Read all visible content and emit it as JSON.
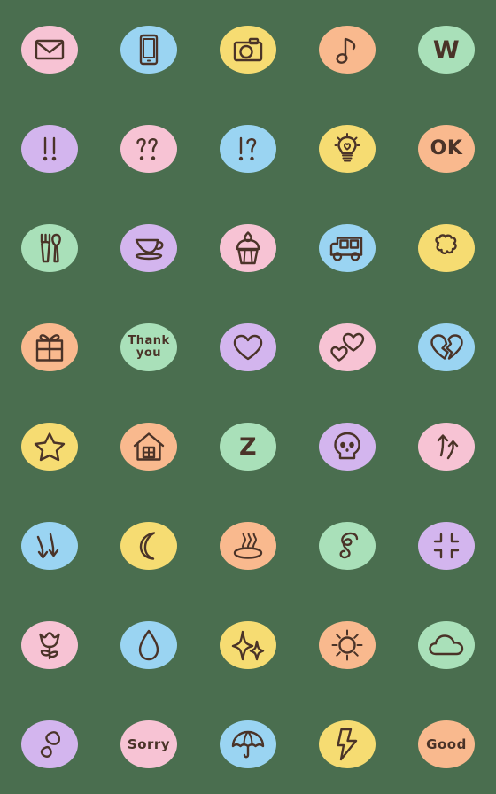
{
  "sheet": {
    "title": "Emoji Sticker Sheet",
    "background_color": "#4a6e4f",
    "ink_color": "#4a3328",
    "columns": 5,
    "rows": 8,
    "palette": {
      "pink": "#f7c3d4",
      "blue": "#9ad4f2",
      "yellow": "#f6dc72",
      "orange": "#f9b98e",
      "green": "#a9e0b9",
      "purple": "#d3b5ee",
      "pink_light": "#f9c9dc"
    }
  },
  "stickers": [
    {
      "row": 1,
      "col": 1,
      "name": "envelope-icon",
      "label": "envelope",
      "color": "#f7c3d4",
      "kind": "icon",
      "text": ""
    },
    {
      "row": 1,
      "col": 2,
      "name": "mobile-phone-icon",
      "label": "mobile phone",
      "color": "#9ad4f2",
      "kind": "icon",
      "text": ""
    },
    {
      "row": 1,
      "col": 3,
      "name": "camera-icon",
      "label": "camera",
      "color": "#f6dc72",
      "kind": "icon",
      "text": ""
    },
    {
      "row": 1,
      "col": 4,
      "name": "music-note-icon",
      "label": "music note",
      "color": "#f9b98e",
      "kind": "icon",
      "text": ""
    },
    {
      "row": 1,
      "col": 5,
      "name": "letter-w-icon",
      "label": "letter W",
      "color": "#a9e0b9",
      "kind": "text",
      "text": "W"
    },
    {
      "row": 2,
      "col": 1,
      "name": "double-exclamation-icon",
      "label": "double exclamation",
      "color": "#d3b5ee",
      "kind": "icon",
      "text": "!!"
    },
    {
      "row": 2,
      "col": 2,
      "name": "double-question-icon",
      "label": "double question",
      "color": "#f7c3d4",
      "kind": "icon",
      "text": "??"
    },
    {
      "row": 2,
      "col": 3,
      "name": "exclamation-question-icon",
      "label": "exclamation question",
      "color": "#9ad4f2",
      "kind": "icon",
      "text": "!?"
    },
    {
      "row": 2,
      "col": 4,
      "name": "lightbulb-icon",
      "label": "light bulb",
      "color": "#f6dc72",
      "kind": "icon",
      "text": ""
    },
    {
      "row": 2,
      "col": 5,
      "name": "ok-text-icon",
      "label": "OK",
      "color": "#f9b98e",
      "kind": "text",
      "text": "OK"
    },
    {
      "row": 3,
      "col": 1,
      "name": "fork-and-spoon-icon",
      "label": "fork and spoon",
      "color": "#a9e0b9",
      "kind": "icon",
      "text": ""
    },
    {
      "row": 3,
      "col": 2,
      "name": "teacup-icon",
      "label": "teacup",
      "color": "#d3b5ee",
      "kind": "icon",
      "text": ""
    },
    {
      "row": 3,
      "col": 3,
      "name": "cupcake-icon",
      "label": "cupcake",
      "color": "#f7c3d4",
      "kind": "icon",
      "text": ""
    },
    {
      "row": 3,
      "col": 4,
      "name": "bus-icon",
      "label": "bus",
      "color": "#9ad4f2",
      "kind": "icon",
      "text": ""
    },
    {
      "row": 3,
      "col": 5,
      "name": "popcorn-icon",
      "label": "popcorn",
      "color": "#f6dc72",
      "kind": "icon",
      "text": ""
    },
    {
      "row": 4,
      "col": 1,
      "name": "gift-icon",
      "label": "gift box",
      "color": "#f9b98e",
      "kind": "icon",
      "text": ""
    },
    {
      "row": 4,
      "col": 2,
      "name": "thank-you-text-icon",
      "label": "Thank you",
      "color": "#a9e0b9",
      "kind": "text2",
      "text": "Thank",
      "text2": "you"
    },
    {
      "row": 4,
      "col": 3,
      "name": "heart-icon",
      "label": "heart",
      "color": "#d3b5ee",
      "kind": "icon",
      "text": ""
    },
    {
      "row": 4,
      "col": 4,
      "name": "two-hearts-icon",
      "label": "two hearts",
      "color": "#f7c3d4",
      "kind": "icon",
      "text": ""
    },
    {
      "row": 4,
      "col": 5,
      "name": "broken-heart-icon",
      "label": "broken heart",
      "color": "#9ad4f2",
      "kind": "icon",
      "text": ""
    },
    {
      "row": 5,
      "col": 1,
      "name": "star-icon",
      "label": "star",
      "color": "#f6dc72",
      "kind": "icon",
      "text": ""
    },
    {
      "row": 5,
      "col": 2,
      "name": "house-icon",
      "label": "house",
      "color": "#f9b98e",
      "kind": "icon",
      "text": ""
    },
    {
      "row": 5,
      "col": 3,
      "name": "sleep-z-icon",
      "label": "sleeping Z",
      "color": "#a9e0b9",
      "kind": "text",
      "text": "Z"
    },
    {
      "row": 5,
      "col": 4,
      "name": "skull-icon",
      "label": "skull",
      "color": "#d3b5ee",
      "kind": "icon",
      "text": ""
    },
    {
      "row": 5,
      "col": 5,
      "name": "up-arrows-icon",
      "label": "up arrows",
      "color": "#f7c3d4",
      "kind": "icon",
      "text": ""
    },
    {
      "row": 6,
      "col": 1,
      "name": "down-arrows-icon",
      "label": "down arrows",
      "color": "#9ad4f2",
      "kind": "icon",
      "text": ""
    },
    {
      "row": 6,
      "col": 2,
      "name": "crescent-moon-icon",
      "label": "crescent moon",
      "color": "#f6dc72",
      "kind": "icon",
      "text": ""
    },
    {
      "row": 6,
      "col": 3,
      "name": "hot-spring-icon",
      "label": "hot spring",
      "color": "#f9b98e",
      "kind": "icon",
      "text": ""
    },
    {
      "row": 6,
      "col": 4,
      "name": "scribble-icon",
      "label": "confusion scribble",
      "color": "#a9e0b9",
      "kind": "icon",
      "text": ""
    },
    {
      "row": 6,
      "col": 5,
      "name": "anger-veins-icon",
      "label": "anger veins",
      "color": "#d3b5ee",
      "kind": "icon",
      "text": ""
    },
    {
      "row": 7,
      "col": 1,
      "name": "tulip-icon",
      "label": "tulip",
      "color": "#f7c3d4",
      "kind": "icon",
      "text": ""
    },
    {
      "row": 7,
      "col": 2,
      "name": "water-drop-icon",
      "label": "water drop",
      "color": "#9ad4f2",
      "kind": "icon",
      "text": ""
    },
    {
      "row": 7,
      "col": 3,
      "name": "sparkles-icon",
      "label": "sparkles",
      "color": "#f6dc72",
      "kind": "icon",
      "text": ""
    },
    {
      "row": 7,
      "col": 4,
      "name": "sun-icon",
      "label": "sun",
      "color": "#f9b98e",
      "kind": "icon",
      "text": ""
    },
    {
      "row": 7,
      "col": 5,
      "name": "cloud-icon",
      "label": "cloud",
      "color": "#a9e0b9",
      "kind": "icon",
      "text": ""
    },
    {
      "row": 8,
      "col": 1,
      "name": "footprints-icon",
      "label": "footprints",
      "color": "#d3b5ee",
      "kind": "icon",
      "text": ""
    },
    {
      "row": 8,
      "col": 2,
      "name": "sorry-text-icon",
      "label": "Sorry",
      "color": "#f7c3d4",
      "kind": "text",
      "text": "Sorry"
    },
    {
      "row": 8,
      "col": 3,
      "name": "umbrella-icon",
      "label": "umbrella",
      "color": "#9ad4f2",
      "kind": "icon",
      "text": ""
    },
    {
      "row": 8,
      "col": 4,
      "name": "lightning-bolt-icon",
      "label": "lightning bolt",
      "color": "#f6dc72",
      "kind": "icon",
      "text": ""
    },
    {
      "row": 8,
      "col": 5,
      "name": "good-text-icon",
      "label": "Good",
      "color": "#f9b98e",
      "kind": "text",
      "text": "Good"
    }
  ]
}
